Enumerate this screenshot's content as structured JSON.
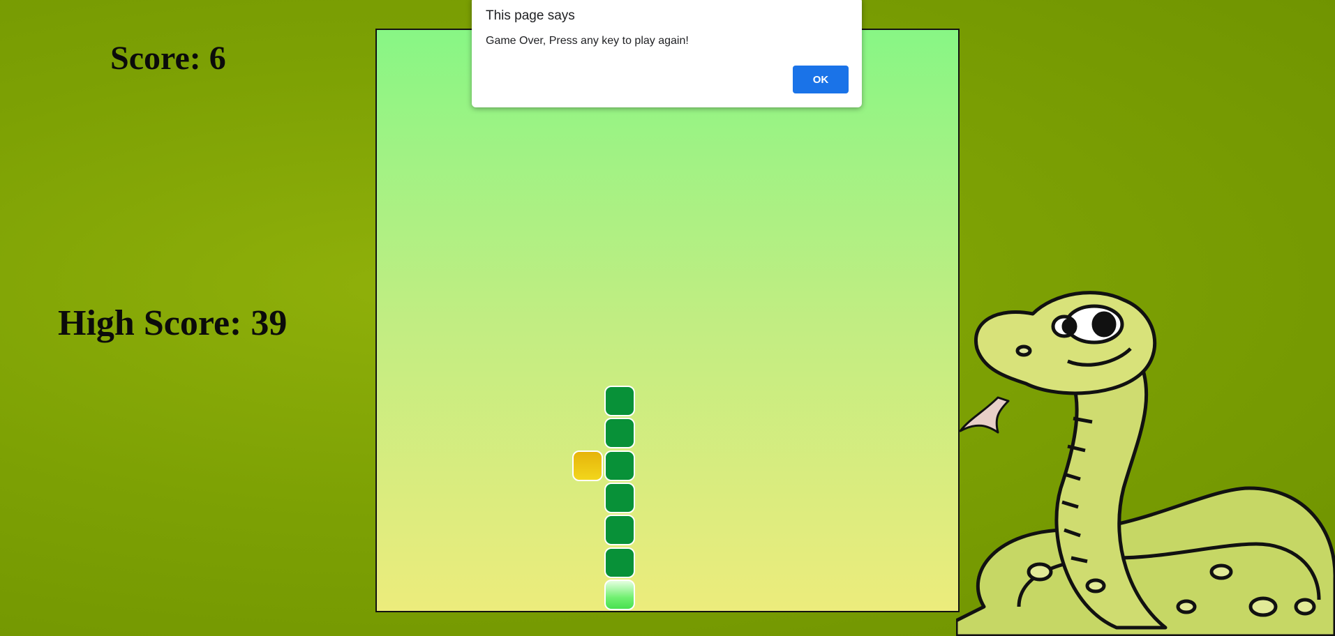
{
  "score": {
    "text": "Score: 6"
  },
  "high_score": {
    "text": "High Score: 39"
  },
  "dialog": {
    "title": "This page says",
    "message": "Game Over, Press any key to play again!",
    "ok_label": "OK",
    "ok_color": "#1a73e8"
  },
  "colors": {
    "background": "#7da104",
    "board_top": "#88f685",
    "board_bottom": "#ecec7c",
    "snake_body": "#089138",
    "snake_head": "#70f070",
    "food": "#f2d61c"
  },
  "game": {
    "grid_size": 18,
    "snake_head": {
      "col": 7,
      "row": 17
    },
    "snake_body": [
      {
        "col": 7,
        "row": 11
      },
      {
        "col": 7,
        "row": 12
      },
      {
        "col": 7,
        "row": 13
      },
      {
        "col": 7,
        "row": 14
      },
      {
        "col": 7,
        "row": 15
      },
      {
        "col": 7,
        "row": 16
      }
    ],
    "food": {
      "col": 6,
      "row": 13
    }
  },
  "icons": {
    "mascot": "cartoon-snake-mascot"
  }
}
